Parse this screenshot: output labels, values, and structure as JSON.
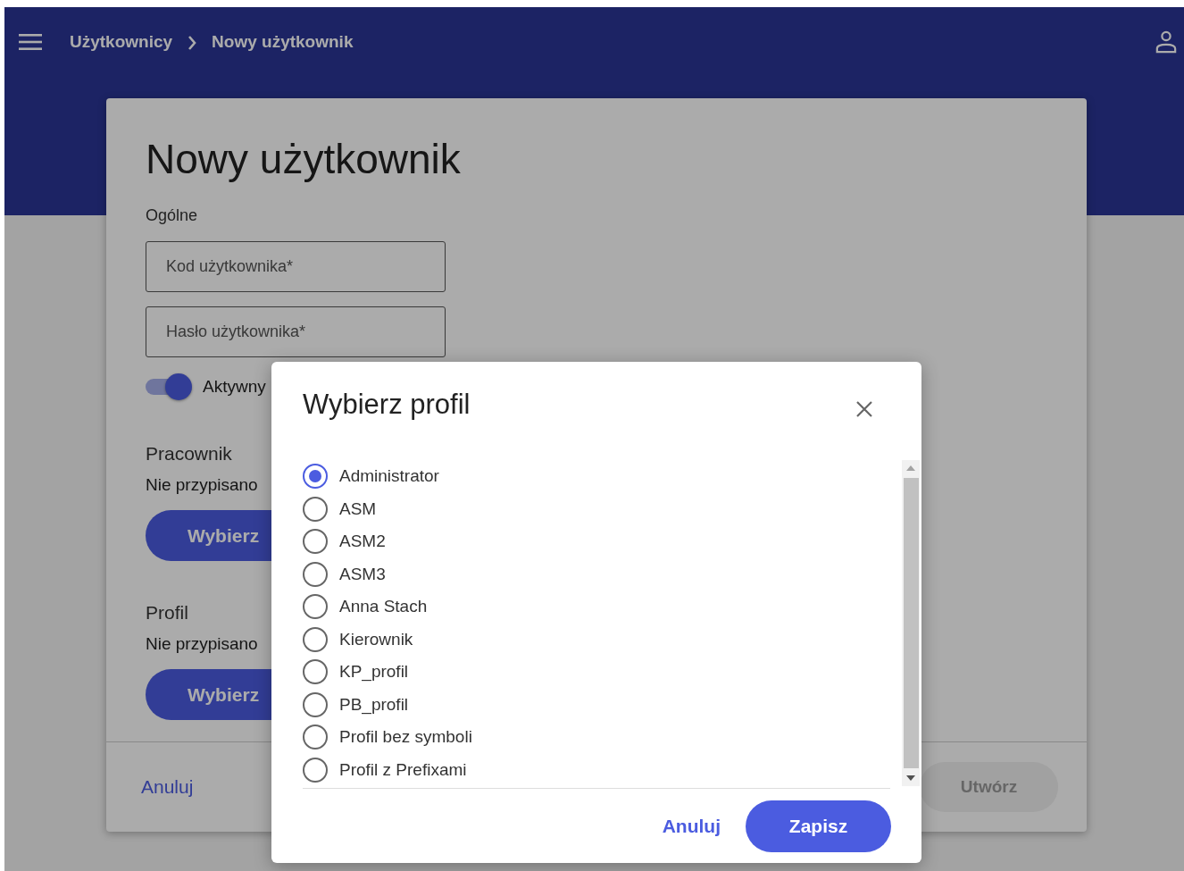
{
  "header": {
    "breadcrumbs": [
      "Użytkownicy",
      "Nowy użytkownik"
    ]
  },
  "form": {
    "title": "Nowy użytkownik",
    "section": "Ogólne",
    "fields": [
      {
        "placeholder": "Kod użytkownika*"
      },
      {
        "placeholder": "Hasło użytkownika*"
      }
    ],
    "active_toggle": {
      "label": "Aktywny",
      "on": true
    },
    "groups": [
      {
        "title": "Pracownik",
        "value": "Nie przypisano",
        "button": "Wybierz"
      },
      {
        "title": "Profil",
        "value": "Nie przypisano",
        "button": "Wybierz"
      }
    ],
    "cancel": "Anuluj",
    "create": {
      "label": "Utwórz",
      "disabled": true
    }
  },
  "dialog": {
    "title": "Wybierz profil",
    "options": [
      {
        "label": "Administrator",
        "selected": true
      },
      {
        "label": "ASM",
        "selected": false
      },
      {
        "label": "ASM2",
        "selected": false
      },
      {
        "label": "ASM3",
        "selected": false
      },
      {
        "label": "Anna Stach",
        "selected": false
      },
      {
        "label": "Kierownik",
        "selected": false
      },
      {
        "label": "KP_profil",
        "selected": false
      },
      {
        "label": "PB_profil",
        "selected": false
      },
      {
        "label": "Profil bez symboli",
        "selected": false
      },
      {
        "label": "Profil z Prefixami",
        "selected": false
      }
    ],
    "cancel": "Anuluj",
    "save": "Zapisz"
  }
}
